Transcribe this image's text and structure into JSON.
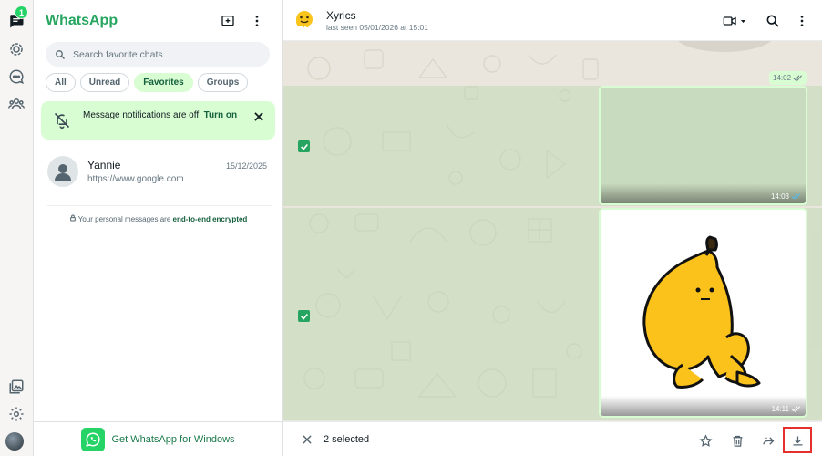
{
  "rail": {
    "chats_badge": "1",
    "icons": [
      "chats-icon",
      "status-icon",
      "channels-icon",
      "communities-icon",
      "media-icon",
      "settings-icon"
    ]
  },
  "sidebar": {
    "brand": "WhatsApp",
    "search_placeholder": "Search favorite chats",
    "filters": [
      {
        "label": "All",
        "active": false
      },
      {
        "label": "Unread",
        "active": false
      },
      {
        "label": "Favorites",
        "active": true
      },
      {
        "label": "Groups",
        "active": false
      }
    ],
    "notice": {
      "text": "Message notifications are off.",
      "link": "Turn on"
    },
    "chats": [
      {
        "name": "Yannie",
        "preview": "https://www.google.com",
        "time": "15/12/2025"
      }
    ],
    "encryption": {
      "prefix": "Your personal messages are",
      "link": "end-to-end encrypted"
    },
    "get_app": "Get WhatsApp for Windows"
  },
  "chat": {
    "name": "Xyrics",
    "status": "last seen 05/01/2026 at 15:01",
    "messages": [
      {
        "time": "14:02"
      },
      {
        "time": "14:03",
        "selected": true
      },
      {
        "time": "14:11",
        "selected": true
      }
    ]
  },
  "selection": {
    "count_label": "2 selected"
  },
  "colors": {
    "brand": "#25a55f",
    "accent_bg": "#d9fdd3",
    "highlight": "#e4312d",
    "wallpaper": "#ebe6dd"
  }
}
